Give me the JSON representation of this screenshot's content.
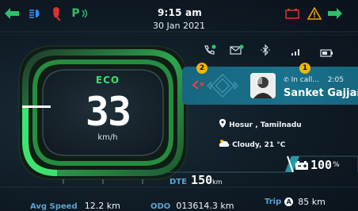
{
  "topbar": {
    "time": "9:15 am",
    "date": "30 Jan 2021",
    "parking_label": "P"
  },
  "mode": {
    "label": "ECO"
  },
  "speed": {
    "value": "33",
    "unit": "km/h"
  },
  "call_panel": {
    "badge_left": "2",
    "badge_right": "1",
    "status": "In call...",
    "duration": "2:05",
    "caller_name": "Sanket Gajjar"
  },
  "location": {
    "text": "Hosur , Tamilnadu"
  },
  "weather": {
    "text": "Cloudy, 21 °C"
  },
  "range": {
    "label": "DTE",
    "value": "150",
    "unit": "km"
  },
  "battery": {
    "percent_value": "100",
    "percent_unit": "%"
  },
  "stats": {
    "avg_speed_label": "Avg Speed",
    "avg_speed_value": "12.2 km",
    "odo_label": "ODO",
    "odo_value": "013614.3 km",
    "trip_label": "Trip",
    "trip_badge": "A",
    "trip_value": "85 km"
  },
  "colors": {
    "accent_green": "#37e06c",
    "turn_signal_green": "#2fbf6b",
    "panel_teal": "#17667f",
    "warning_red": "#e03131",
    "warning_amber": "#f2a300",
    "badge_yellow": "#f2b600",
    "label_blue": "#5aa4cf"
  },
  "icons": [
    "left-turn-icon",
    "headlight-icon",
    "side-stand-icon",
    "parking-icon",
    "battery-warning-icon",
    "hazard-warning-icon",
    "right-turn-icon",
    "phone-icon",
    "message-icon",
    "bluetooth-icon",
    "signal-icon",
    "phone-battery-icon",
    "reject-call-icon",
    "nav-pad-icon",
    "avatar",
    "location-pin-icon",
    "cloudy-icon",
    "vehicle-battery-icon"
  ]
}
